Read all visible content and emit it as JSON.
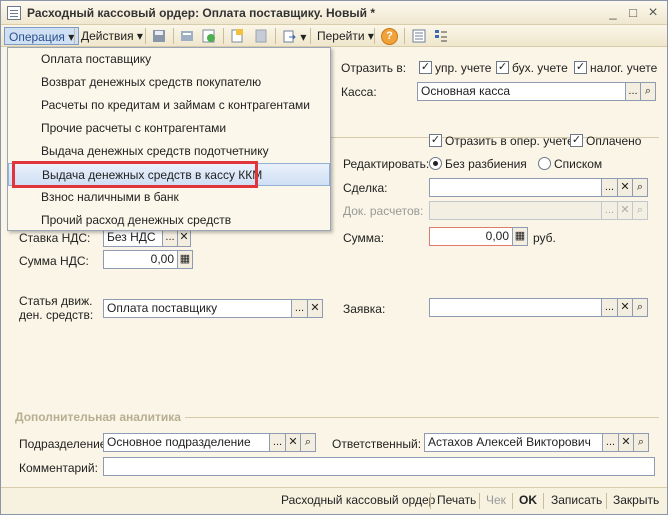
{
  "window": {
    "title": "Расходный кассовый ордер: Оплата поставщику. Новый *",
    "minimize": "_",
    "maximize": "□",
    "close": "×"
  },
  "toolbar": {
    "operation": "Операция",
    "actions": "Действия",
    "goto": "Перейти",
    "help": "?"
  },
  "menu": {
    "items": [
      "Оплата поставщику",
      "Возврат денежных средств покупателю",
      "Расчеты по кредитам и займам с контрагентами",
      "Прочие расчеты с контрагентами",
      "Выдача денежных средств подотчетнику",
      "Выдача денежных средств в кассу ККМ",
      "Взнос наличными в банк",
      "Прочий расход денежных средств"
    ],
    "highlighted_index": 5
  },
  "reflect": {
    "label": "Отразить в:",
    "upr": "упр. учете",
    "buh": "бух. учете",
    "nalog": "налог. учете"
  },
  "kassa": {
    "label": "Касса:",
    "value": "Основная касса"
  },
  "flags": {
    "oper": "Отразить в опер. учете",
    "paid": "Оплачено"
  },
  "edit": {
    "label": "Редактировать:",
    "option1": "Без разбиения",
    "option2": "Списком"
  },
  "deal": {
    "label": "Сделка:",
    "value": ""
  },
  "docs": {
    "label": "Док. расчетов:",
    "value": ""
  },
  "nds_rate": {
    "label": "Ставка НДС:",
    "value": "Без НДС"
  },
  "sum": {
    "label": "Сумма:",
    "value": "0,00",
    "unit": "руб."
  },
  "nds_sum": {
    "label": "Сумма НДС:",
    "value": "0,00"
  },
  "cashflow": {
    "label1": "Статья движ.",
    "label2": "ден. средств:",
    "value": "Оплата поставщику"
  },
  "request": {
    "label": "Заявка:",
    "value": ""
  },
  "extra": {
    "title": "Дополнительная аналитика"
  },
  "division": {
    "label": "Подразделение:",
    "value": "Основное подразделение"
  },
  "responsible": {
    "label": "Ответственный:",
    "value": "Астахов Алексей Викторович"
  },
  "comment": {
    "label": "Комментарий:",
    "value": ""
  },
  "footer": {
    "rko": "Расходный кассовый ордер",
    "print": "Печать",
    "check": "Чек",
    "ok": "OK",
    "save": "Записать",
    "close": "Закрыть"
  },
  "symbols": {
    "dots": "...",
    "clear": "✕",
    "search": "⌕",
    "calc": "▦",
    "check": "✓",
    "arrow": "▾"
  }
}
